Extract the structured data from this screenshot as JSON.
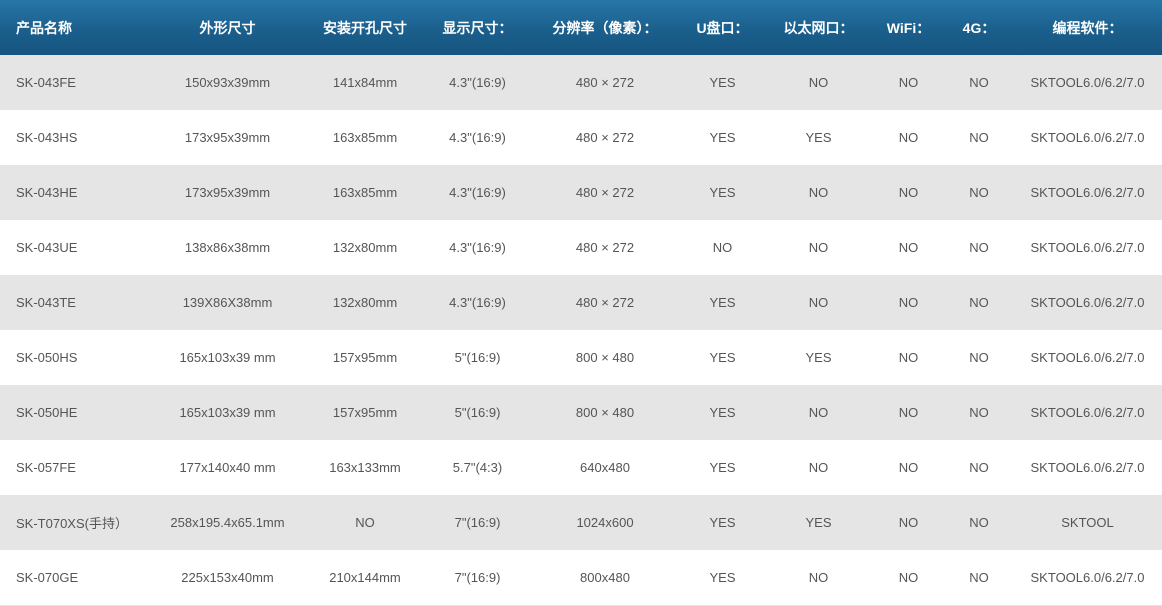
{
  "table": {
    "headers": [
      "产品名称",
      "外形尺寸",
      "安装开孔尺寸",
      "显示尺寸：",
      "分辨率（像素）：",
      "U盘口：",
      "以太网口：",
      "WiFi：",
      "4G：",
      "编程软件："
    ],
    "rows": [
      [
        "SK-043FE",
        "150x93x39mm",
        "141x84mm",
        "4.3\"(16:9)",
        "480 × 272",
        "YES",
        "NO",
        "NO",
        "NO",
        "SKTOOL6.0/6.2/7.0"
      ],
      [
        "SK-043HS",
        "173x95x39mm",
        "163x85mm",
        "4.3\"(16:9)",
        "480 × 272",
        "YES",
        "YES",
        "NO",
        "NO",
        "SKTOOL6.0/6.2/7.0"
      ],
      [
        "SK-043HE",
        "173x95x39mm",
        "163x85mm",
        "4.3\"(16:9)",
        "480 × 272",
        "YES",
        "NO",
        "NO",
        "NO",
        "SKTOOL6.0/6.2/7.0"
      ],
      [
        "SK-043UE",
        "138x86x38mm",
        "132x80mm",
        "4.3\"(16:9)",
        "480 × 272",
        "NO",
        "NO",
        "NO",
        "NO",
        "SKTOOL6.0/6.2/7.0"
      ],
      [
        "SK-043TE",
        "139X86X38mm",
        "132x80mm",
        "4.3\"(16:9)",
        "480 × 272",
        "YES",
        "NO",
        "NO",
        "NO",
        "SKTOOL6.0/6.2/7.0"
      ],
      [
        "SK-050HS",
        "165x103x39 mm",
        "157x95mm",
        "5\"(16:9)",
        "800 × 480",
        "YES",
        "YES",
        "NO",
        "NO",
        "SKTOOL6.0/6.2/7.0"
      ],
      [
        "SK-050HE",
        "165x103x39 mm",
        "157x95mm",
        "5\"(16:9)",
        "800 × 480",
        "YES",
        "NO",
        "NO",
        "NO",
        "SKTOOL6.0/6.2/7.0"
      ],
      [
        "SK-057FE",
        "177x140x40 mm",
        "163x133mm",
        "5.7\"(4:3)",
        "640x480",
        "YES",
        "NO",
        "NO",
        "NO",
        "SKTOOL6.0/6.2/7.0"
      ],
      [
        "SK-T070XS(手持）",
        "258x195.4x65.1mm",
        "NO",
        "7\"(16:9)",
        "1024x600",
        "YES",
        "YES",
        "NO",
        "NO",
        "SKTOOL"
      ],
      [
        "SK-070GE",
        "225x153x40mm",
        "210x144mm",
        "7\"(16:9)",
        "800x480",
        "YES",
        "NO",
        "NO",
        "NO",
        "SKTOOL6.0/6.2/7.0"
      ]
    ]
  },
  "colors": {
    "header_bg": "#1b5f8c",
    "header_text": "#ffffff",
    "row_odd": "#e5e5e5",
    "row_even": "#ffffff",
    "cell_text": "#555555"
  }
}
